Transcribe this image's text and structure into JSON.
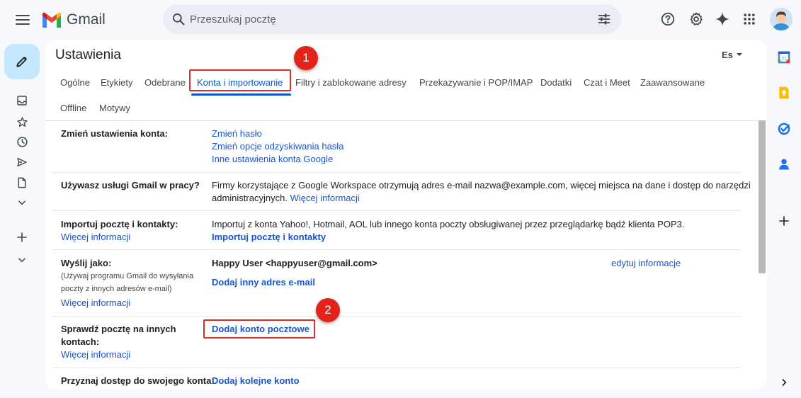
{
  "app": {
    "name": "Gmail",
    "search_placeholder": "Przeszukaj pocztę"
  },
  "settings": {
    "title": "Ustawienia",
    "language": "Es",
    "tabs": [
      {
        "label": "Ogólne"
      },
      {
        "label": "Etykiety"
      },
      {
        "label": "Odebrane"
      },
      {
        "label": "Konta i importowanie",
        "active": true
      },
      {
        "label": "Filtry i zablokowane adresy"
      },
      {
        "label": "Przekazywanie i POP/IMAP"
      },
      {
        "label": "Dodatki"
      },
      {
        "label": "Czat i Meet"
      },
      {
        "label": "Zaawansowane"
      },
      {
        "label": "Offline"
      },
      {
        "label": "Motywy"
      }
    ],
    "rows": {
      "change_account": {
        "label": "Zmień ustawienia konta:",
        "links": [
          "Zmień hasło",
          "Zmień opcje odzyskiwania hasła",
          "Inne ustawienia konta Google"
        ]
      },
      "gmail_work": {
        "label": "Używasz usługi Gmail w pracy?",
        "text": "Firmy korzystające z Google Workspace otrzymują adres e-mail nazwa@example.com, więcej miejsca na dane i dostęp do narzędzi",
        "text2": "administracyjnych.",
        "link": "Więcej informacji"
      },
      "import": {
        "label": "Importuj pocztę i kontakty:",
        "link": "Więcej informacji",
        "text": "Importuj z konta Yahoo!, Hotmail, AOL lub innego konta poczty obsługiwanej przez przeglądarkę bądź klienta POP3.",
        "action": "Importuj pocztę i kontakty"
      },
      "send_as": {
        "label": "Wyślij jako:",
        "sub1": "(Używaj programu Gmail do wysyłania",
        "sub2": "poczty z innych adresów e-mail)",
        "link": "Więcej informacji",
        "identity": "Happy User <happyuser@gmail.com>",
        "edit": "edytuj informacje",
        "add": "Dodaj inny adres e-mail"
      },
      "check_mail": {
        "label1": "Sprawdź pocztę na innych",
        "label2": "kontach:",
        "link": "Więcej informacji",
        "action": "Dodaj konto pocztowe"
      },
      "grant_access": {
        "label": "Przyznaj dostęp do swojego konta:",
        "action": "Dodaj kolejne konto"
      }
    }
  },
  "annotations": {
    "step1": "1",
    "step2": "2",
    "highlight_color": "#d93025",
    "badge_color": "#e2231a"
  },
  "colors": {
    "accent": "#0b57d0",
    "link": "#1a55c9",
    "background": "#f6f8fc",
    "compose": "#c2e7ff"
  },
  "icons": {
    "left_rail": [
      "inbox-icon",
      "star-icon",
      "clock-icon",
      "send-icon",
      "draft-icon",
      "chevron-down-icon",
      "plus-icon",
      "chevron-down-icon"
    ],
    "right_rail": [
      "calendar-icon",
      "keep-icon",
      "tasks-icon",
      "contacts-icon",
      "plus-icon",
      "chevron-right-icon"
    ],
    "top": [
      "help-icon",
      "gear-icon",
      "gemini-icon",
      "apps-grid-icon"
    ]
  }
}
